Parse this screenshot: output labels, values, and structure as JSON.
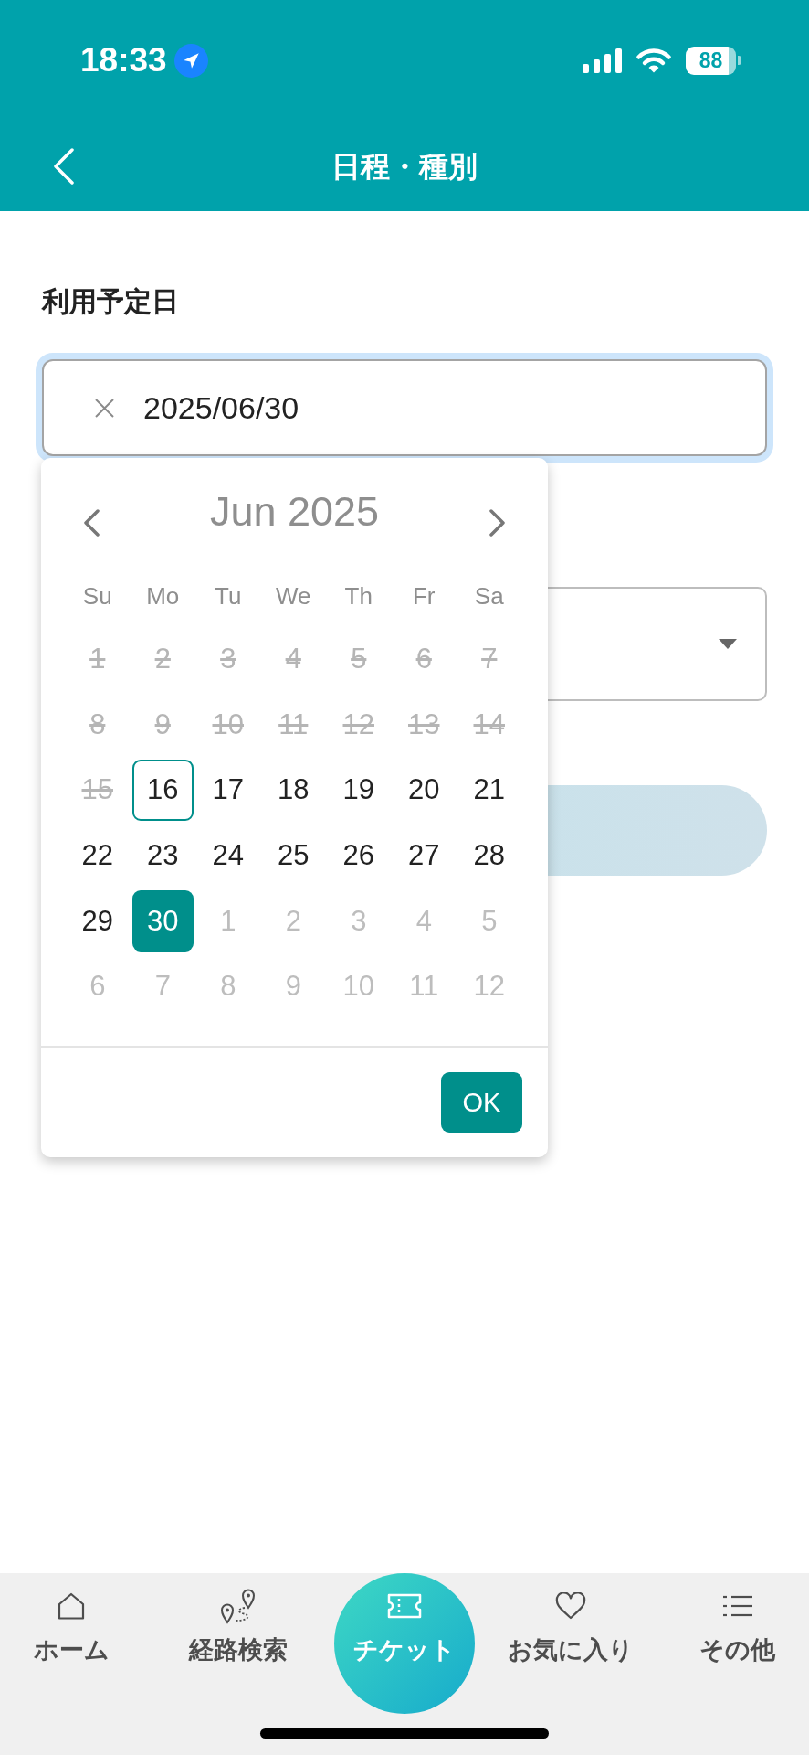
{
  "status_bar": {
    "time": "18:33",
    "battery": "88"
  },
  "header": {
    "title": "日程・種別"
  },
  "form": {
    "date_label": "利用予定日",
    "date_field": {
      "value": "2025/06/30",
      "focused": true
    },
    "type_select": {
      "expanded": false
    },
    "submit_button": {
      "disabled": true
    }
  },
  "datepicker": {
    "month": "Jun 2025",
    "weekdays": [
      "Su",
      "Mo",
      "Tu",
      "We",
      "Th",
      "Fr",
      "Sa"
    ],
    "weeks": [
      [
        {
          "day": "1",
          "kind": "past",
          "today": false,
          "selected": false
        },
        {
          "day": "2",
          "kind": "past",
          "today": false,
          "selected": false
        },
        {
          "day": "3",
          "kind": "past",
          "today": false,
          "selected": false
        },
        {
          "day": "4",
          "kind": "past",
          "today": false,
          "selected": false
        },
        {
          "day": "5",
          "kind": "past",
          "today": false,
          "selected": false
        },
        {
          "day": "6",
          "kind": "past",
          "today": false,
          "selected": false
        },
        {
          "day": "7",
          "kind": "past",
          "today": false,
          "selected": false
        }
      ],
      [
        {
          "day": "8",
          "kind": "past",
          "today": false,
          "selected": false
        },
        {
          "day": "9",
          "kind": "past",
          "today": false,
          "selected": false
        },
        {
          "day": "10",
          "kind": "past",
          "today": false,
          "selected": false
        },
        {
          "day": "11",
          "kind": "past",
          "today": false,
          "selected": false
        },
        {
          "day": "12",
          "kind": "past",
          "today": false,
          "selected": false
        },
        {
          "day": "13",
          "kind": "past",
          "today": false,
          "selected": false
        },
        {
          "day": "14",
          "kind": "past",
          "today": false,
          "selected": false
        }
      ],
      [
        {
          "day": "15",
          "kind": "past",
          "today": false,
          "selected": false
        },
        {
          "day": "16",
          "kind": "current",
          "today": true,
          "selected": false
        },
        {
          "day": "17",
          "kind": "current",
          "today": false,
          "selected": false
        },
        {
          "day": "18",
          "kind": "current",
          "today": false,
          "selected": false
        },
        {
          "day": "19",
          "kind": "current",
          "today": false,
          "selected": false
        },
        {
          "day": "20",
          "kind": "current",
          "today": false,
          "selected": false
        },
        {
          "day": "21",
          "kind": "current",
          "today": false,
          "selected": false
        }
      ],
      [
        {
          "day": "22",
          "kind": "current",
          "today": false,
          "selected": false
        },
        {
          "day": "23",
          "kind": "current",
          "today": false,
          "selected": false
        },
        {
          "day": "24",
          "kind": "current",
          "today": false,
          "selected": false
        },
        {
          "day": "25",
          "kind": "current",
          "today": false,
          "selected": false
        },
        {
          "day": "26",
          "kind": "current",
          "today": false,
          "selected": false
        },
        {
          "day": "27",
          "kind": "current",
          "today": false,
          "selected": false
        },
        {
          "day": "28",
          "kind": "current",
          "today": false,
          "selected": false
        }
      ],
      [
        {
          "day": "29",
          "kind": "current",
          "today": false,
          "selected": false
        },
        {
          "day": "30",
          "kind": "current",
          "today": false,
          "selected": true
        },
        {
          "day": "1",
          "kind": "other_month",
          "today": false,
          "selected": false
        },
        {
          "day": "2",
          "kind": "other_month",
          "today": false,
          "selected": false
        },
        {
          "day": "3",
          "kind": "other_month",
          "today": false,
          "selected": false
        },
        {
          "day": "4",
          "kind": "other_month",
          "today": false,
          "selected": false
        },
        {
          "day": "5",
          "kind": "other_month",
          "today": false,
          "selected": false
        }
      ],
      [
        {
          "day": "6",
          "kind": "other_month",
          "today": false,
          "selected": false
        },
        {
          "day": "7",
          "kind": "other_month",
          "today": false,
          "selected": false
        },
        {
          "day": "8",
          "kind": "other_month",
          "today": false,
          "selected": false
        },
        {
          "day": "9",
          "kind": "other_month",
          "today": false,
          "selected": false
        },
        {
          "day": "10",
          "kind": "other_month",
          "today": false,
          "selected": false
        },
        {
          "day": "11",
          "kind": "other_month",
          "today": false,
          "selected": false
        },
        {
          "day": "12",
          "kind": "other_month",
          "today": false,
          "selected": false
        }
      ]
    ],
    "ok": "OK"
  },
  "bottom_nav": [
    {
      "label": "ホーム",
      "selected": false
    },
    {
      "label": "経路検索",
      "selected": false
    },
    {
      "label": "チケット",
      "selected": true
    },
    {
      "label": "お気に入り",
      "selected": false
    },
    {
      "label": "その他",
      "selected": false
    }
  ]
}
